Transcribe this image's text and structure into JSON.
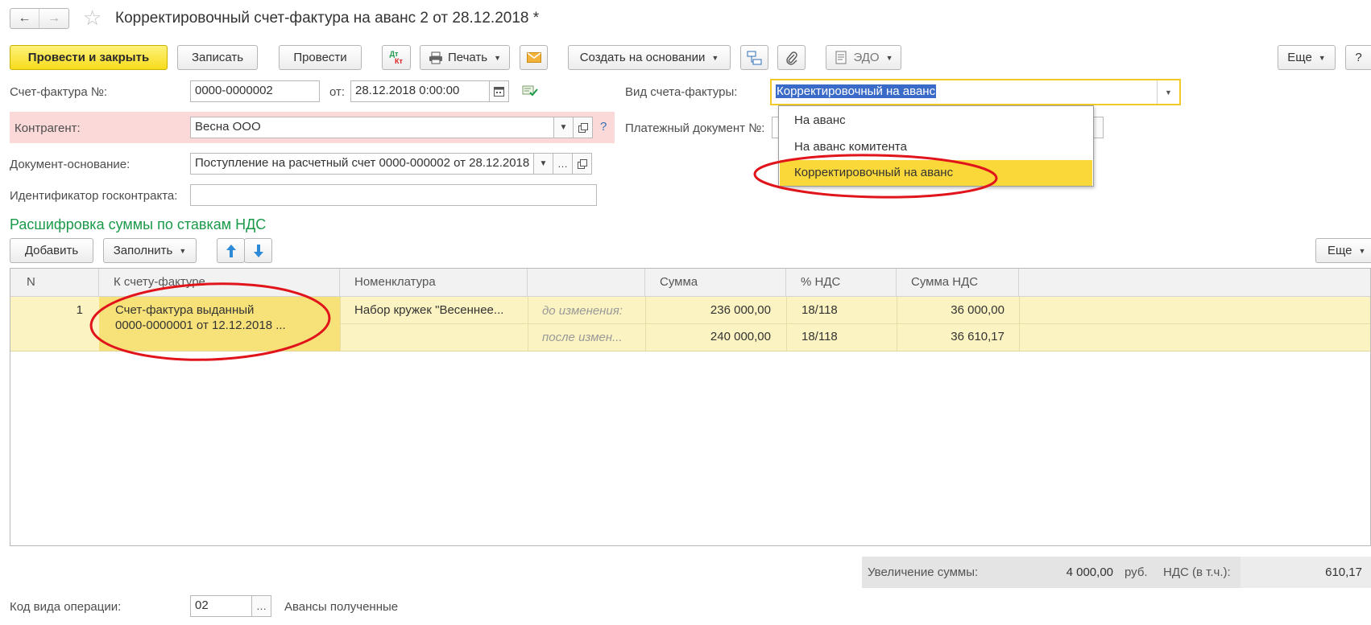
{
  "window": {
    "title": "Корректировочный счет-фактура на аванс 2 от 28.12.2018 *"
  },
  "toolbar": {
    "post_close": "Провести и закрыть",
    "save": "Записать",
    "post": "Провести",
    "dt_kt_top": "Дт",
    "dt_kt_bottom": "Кт",
    "print": "Печать",
    "create_based": "Создать на основании",
    "edo": "ЭДО",
    "more": "Еще",
    "help": "?"
  },
  "form": {
    "invoice_no_label": "Счет-фактура №:",
    "invoice_no": "0000-0000002",
    "date_label": "от:",
    "date": "28.12.2018  0:00:00",
    "invoice_type_label": "Вид счета-фактуры:",
    "invoice_type": "Корректировочный на аванс",
    "contractor_label": "Контрагент:",
    "contractor": "Весна ООО",
    "contractor_help": "?",
    "payment_doc_label": "Платежный документ №:",
    "basis_doc_label": "Документ-основание:",
    "basis_doc": "Поступление на расчетный счет 0000-000002 от 28.12.2018",
    "gov_contract_label": "Идентификатор госконтракта:",
    "gov_contract": ""
  },
  "dropdown": {
    "options": [
      "На аванс",
      "На аванс комитента",
      "Корректировочный на аванс"
    ],
    "selected_index": 2
  },
  "section": {
    "title": "Расшифровка суммы по ставкам НДС",
    "add": "Добавить",
    "fill": "Заполнить",
    "more": "Еще"
  },
  "table": {
    "headers": [
      "N",
      "К счету-фактуре",
      "Номенклатура",
      "",
      "Сумма",
      "% НДС",
      "Сумма НДС"
    ],
    "row": {
      "n": "1",
      "invoice_line1": "Счет-фактура выданный",
      "invoice_line2": "0000-0000001 от 12.12.2018 ...",
      "nomenclature": "Набор кружек \"Весеннее...",
      "before_label": "до изменения:",
      "after_label": "после измен...",
      "sum_before": "236 000,00",
      "sum_after": "240 000,00",
      "vat_rate_before": "18/118",
      "vat_rate_after": "18/118",
      "vat_before": "36 000,00",
      "vat_after": "36 610,17"
    }
  },
  "totals": {
    "increase_label": "Увеличение суммы:",
    "increase_value": "4 000,00",
    "currency": "руб.",
    "vat_label": "НДС (в т.ч.):",
    "vat_value": "610,17"
  },
  "footer": {
    "op_code_label": "Код вида операции:",
    "op_code": "02",
    "op_code_desc": "Авансы полученные"
  },
  "colors": {
    "accent_yellow": "#f7dc1c",
    "selection_yellow": "#fad83a",
    "row_yellow": "#fbf3c1",
    "section_green": "#1a9a49",
    "contractor_pink": "#fbd9d9",
    "annotation_red": "#e0141a"
  }
}
